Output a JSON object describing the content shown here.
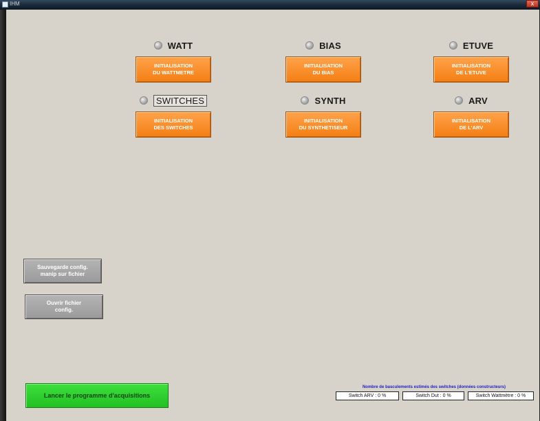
{
  "window": {
    "title": "IHM",
    "close_glyph": "x"
  },
  "modules": [
    {
      "id": "watt",
      "label": "WATT",
      "button": "INITIALISATION\nDU WATTMETRE"
    },
    {
      "id": "bias",
      "label": "BIAS",
      "button": "INITIALISATION\nDU BIAS"
    },
    {
      "id": "etuve",
      "label": "ETUVE",
      "button": "INITIALISATION\nDE L'ETUVE"
    },
    {
      "id": "switches",
      "label": "SWITCHES",
      "button": "INITIALISATION\nDES SWITCHES"
    },
    {
      "id": "synth",
      "label": "SYNTH",
      "button": "INITIALISATION\nDU SYNTHETISEUR"
    },
    {
      "id": "arv",
      "label": "ARV",
      "button": "INITIALISATION\nDE L'ARV"
    }
  ],
  "config": {
    "save_label": "Sauvegarde config.\nmanip sur fichier",
    "open_label": "Ouvrir fichier\nconfig."
  },
  "launch": {
    "label": "Lancer le programme d'acquisitions"
  },
  "switch_counts": {
    "caption": "Nombre de basculements estimés des switches (données constructeurs)",
    "arv": "Switch ARV : 0 %",
    "dut": "Switch Dut : 0 %",
    "wattmetre": "Switch Wattmètre : 0 %"
  },
  "colors": {
    "orange_button": "#f47f14",
    "green_button": "#22c022",
    "gray_button": "#9a9a9a",
    "background": "#d7d3cb",
    "caption_blue": "#2020c0"
  },
  "icons": {
    "led": "status-led-gray"
  }
}
